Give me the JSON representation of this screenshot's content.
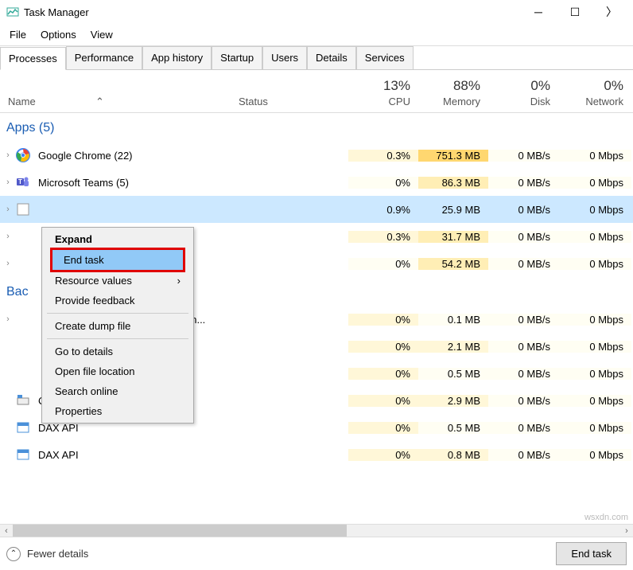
{
  "window": {
    "title": "Task Manager"
  },
  "menu": {
    "file": "File",
    "options": "Options",
    "view": "View"
  },
  "tabs": {
    "processes": "Processes",
    "performance": "Performance",
    "app_history": "App history",
    "startup": "Startup",
    "users": "Users",
    "details": "Details",
    "services": "Services"
  },
  "columns": {
    "name": "Name",
    "status": "Status",
    "cpu": "CPU",
    "cpu_val": "13%",
    "memory": "Memory",
    "memory_val": "88%",
    "disk": "Disk",
    "disk_val": "0%",
    "network": "Network",
    "network_val": "0%"
  },
  "sections": {
    "apps": "Apps (5)",
    "background": "Bac"
  },
  "rows": [
    {
      "name": "Google Chrome (22)",
      "cpu": "0.3%",
      "mem": "751.3 MB",
      "disk": "0 MB/s",
      "net": "0 Mbps",
      "icon": "chrome"
    },
    {
      "name": "Microsoft Teams (5)",
      "cpu": "0%",
      "mem": "86.3 MB",
      "disk": "0 MB/s",
      "net": "0 Mbps",
      "icon": "teams"
    },
    {
      "name": "",
      "cpu": "0.9%",
      "mem": "25.9 MB",
      "disk": "0 MB/s",
      "net": "0 Mbps",
      "icon": "blank",
      "selected": true
    },
    {
      "name": "",
      "cpu": "0.3%",
      "mem": "31.7 MB",
      "disk": "0 MB/s",
      "net": "0 Mbps",
      "icon": "blank"
    },
    {
      "name": "",
      "cpu": "0%",
      "mem": "54.2 MB",
      "disk": "0 MB/s",
      "net": "0 Mbps",
      "icon": "blank"
    }
  ],
  "bg_rows": [
    {
      "name": "…an...",
      "cpu": "0%",
      "mem": "0.1 MB",
      "disk": "0 MB/s",
      "net": "0 Mbps",
      "icon": "blank"
    },
    {
      "name": "",
      "cpu": "0%",
      "mem": "2.1 MB",
      "disk": "0 MB/s",
      "net": "0 Mbps",
      "icon": "blank"
    },
    {
      "name": "",
      "cpu": "0%",
      "mem": "0.5 MB",
      "disk": "0 MB/s",
      "net": "0 Mbps",
      "icon": "blank"
    },
    {
      "name": "CTF Loader",
      "cpu": "0%",
      "mem": "2.9 MB",
      "disk": "0 MB/s",
      "net": "0 Mbps",
      "icon": "ctf"
    },
    {
      "name": "DAX API",
      "cpu": "0%",
      "mem": "0.5 MB",
      "disk": "0 MB/s",
      "net": "0 Mbps",
      "icon": "dax"
    },
    {
      "name": "DAX API",
      "cpu": "0%",
      "mem": "0.8 MB",
      "disk": "0 MB/s",
      "net": "0 Mbps",
      "icon": "dax"
    }
  ],
  "context_menu": {
    "expand": "Expand",
    "end_task": "End task",
    "resource_values": "Resource values",
    "provide_feedback": "Provide feedback",
    "create_dump": "Create dump file",
    "go_to_details": "Go to details",
    "open_location": "Open file location",
    "search_online": "Search online",
    "properties": "Properties"
  },
  "footer": {
    "fewer": "Fewer details",
    "end_task": "End task"
  },
  "watermark": "wsxdn.com"
}
